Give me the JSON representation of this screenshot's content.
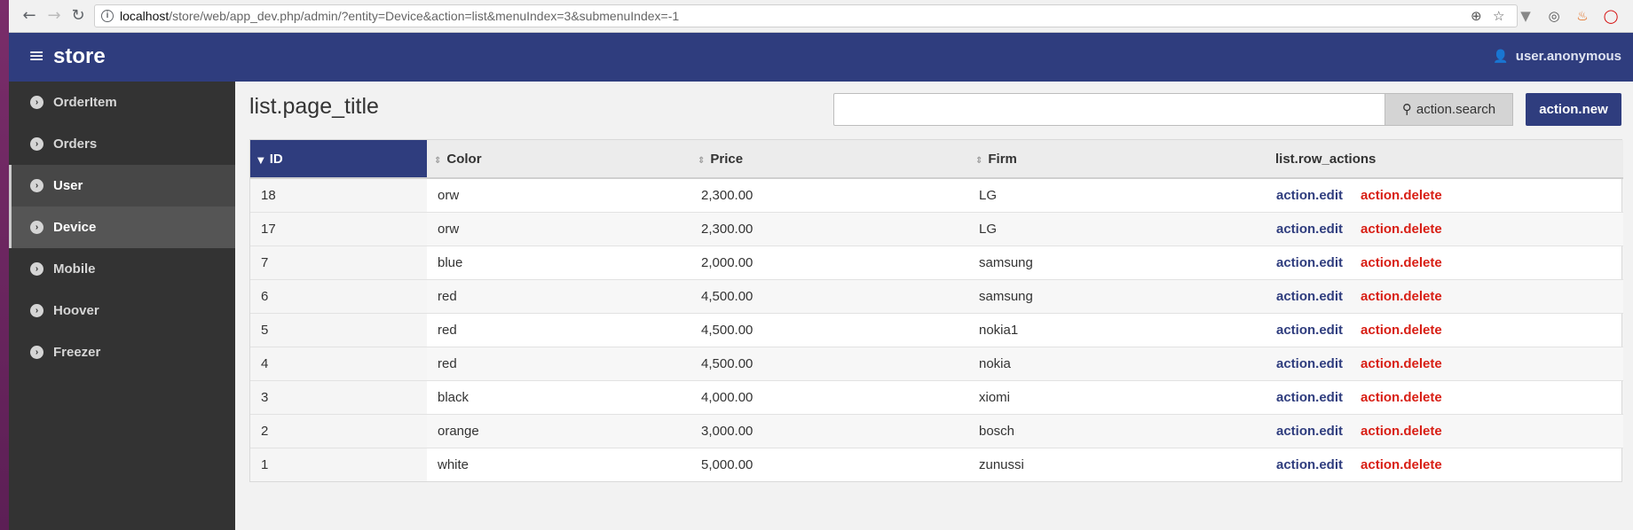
{
  "browser": {
    "url_host": "localhost",
    "url_path": "/store/web/app_dev.php/admin/?entity=Device&action=list&menuIndex=3&submenuIndex=-1"
  },
  "header": {
    "brand": "store",
    "user": "user.anonymous",
    "color": "#2f3d7e"
  },
  "sidebar": {
    "items": [
      {
        "label": "OrderItem"
      },
      {
        "label": "Orders"
      },
      {
        "label": "User"
      },
      {
        "label": "Device"
      },
      {
        "label": "Mobile"
      },
      {
        "label": "Hoover"
      },
      {
        "label": "Freezer"
      }
    ]
  },
  "main": {
    "page_title": "list.page_title",
    "search_placeholder": "",
    "search_button": "action.search",
    "new_button": "action.new"
  },
  "table": {
    "columns": [
      "ID",
      "Color",
      "Price",
      "Firm",
      "list.row_actions"
    ],
    "sorted_column": "ID",
    "rows": [
      {
        "id": "18",
        "color": "orw",
        "price": "2,300.00",
        "firm": "LG",
        "edit": "action.edit",
        "delete": "action.delete"
      },
      {
        "id": "17",
        "color": "orw",
        "price": "2,300.00",
        "firm": "LG",
        "edit": "action.edit",
        "delete": "action.delete"
      },
      {
        "id": "7",
        "color": "blue",
        "price": "2,000.00",
        "firm": "samsung",
        "edit": "action.edit",
        "delete": "action.delete"
      },
      {
        "id": "6",
        "color": "red",
        "price": "4,500.00",
        "firm": "samsung",
        "edit": "action.edit",
        "delete": "action.delete"
      },
      {
        "id": "5",
        "color": "red",
        "price": "4,500.00",
        "firm": "nokia1",
        "edit": "action.edit",
        "delete": "action.delete"
      },
      {
        "id": "4",
        "color": "red",
        "price": "4,500.00",
        "firm": "nokia",
        "edit": "action.edit",
        "delete": "action.delete"
      },
      {
        "id": "3",
        "color": "black",
        "price": "4,000.00",
        "firm": "xiomi",
        "edit": "action.edit",
        "delete": "action.delete"
      },
      {
        "id": "2",
        "color": "orange",
        "price": "3,000.00",
        "firm": "bosch",
        "edit": "action.edit",
        "delete": "action.delete"
      },
      {
        "id": "1",
        "color": "white",
        "price": "5,000.00",
        "firm": "zunussi",
        "edit": "action.edit",
        "delete": "action.delete"
      }
    ]
  }
}
